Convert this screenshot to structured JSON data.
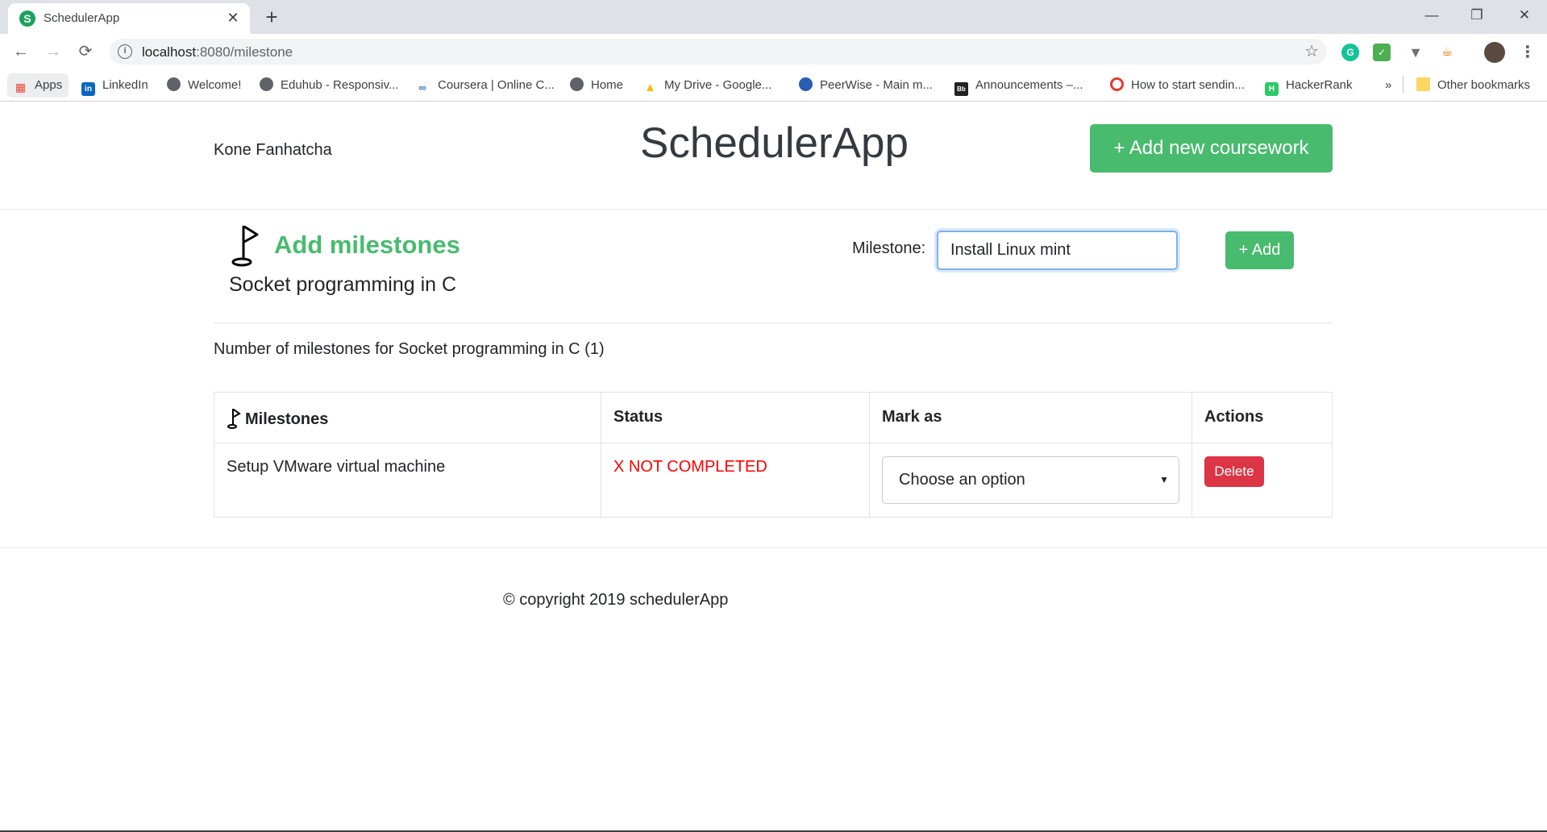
{
  "browser": {
    "tab_title": "SchedulerApp",
    "tab_favicon": "S",
    "url_host": "localhost",
    "url_path": ":8080/milestone",
    "bookmarks": [
      {
        "label": "Apps"
      },
      {
        "label": "LinkedIn"
      },
      {
        "label": "Welcome!"
      },
      {
        "label": "Eduhub - Responsiv..."
      },
      {
        "label": "Coursera | Online C..."
      },
      {
        "label": "Home"
      },
      {
        "label": "My Drive - Google..."
      },
      {
        "label": "PeerWise - Main m..."
      },
      {
        "label": "Announcements –..."
      },
      {
        "label": "How to start sendin..."
      },
      {
        "label": "HackerRank"
      },
      {
        "label": "Other bookmarks"
      }
    ],
    "overflow": "»"
  },
  "header": {
    "user_name": "Kone Fanhatcha",
    "brand": "SchedulerApp",
    "add_coursework_label": "+ Add new coursework"
  },
  "milestone_form": {
    "title": "Add milestones",
    "course_name": "Socket programming in C",
    "label": "Milestone:",
    "input_value": "Install Linux mint",
    "add_label": "+ Add"
  },
  "summary": {
    "count_text": "Number of milestones for Socket programming in C (1)"
  },
  "table": {
    "headers": {
      "milestones": "Milestones",
      "status": "Status",
      "mark_as": "Mark as",
      "actions": "Actions"
    },
    "rows": [
      {
        "milestone": "Setup VMware virtual machine",
        "status": "X NOT COMPLETED",
        "mark_as_selected": "Choose an option",
        "action_label": "Delete"
      }
    ]
  },
  "footer": {
    "copyright": "© copyright 2019 schedulerApp"
  },
  "colors": {
    "brand_green": "#48bb6e",
    "danger_red": "#dc3545",
    "status_red": "#ff0000"
  }
}
